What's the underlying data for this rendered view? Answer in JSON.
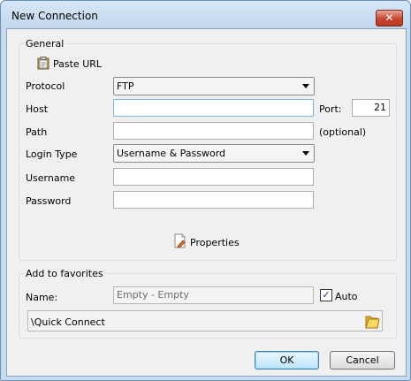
{
  "window": {
    "title": "New Connection",
    "close_label": "✕"
  },
  "general": {
    "group_label": "General",
    "paste_url_label": "Paste URL",
    "protocol_label": "Protocol",
    "protocol_value": "FTP",
    "host_label": "Host",
    "host_value": "",
    "port_label": "Port:",
    "port_value": "21",
    "path_label": "Path",
    "path_value": "",
    "optional_label": "(optional)",
    "login_type_label": "Login Type",
    "login_type_value": "Username & Password",
    "username_label": "Username",
    "username_value": "",
    "password_label": "Password",
    "password_value": "",
    "properties_label": "Properties"
  },
  "favorites": {
    "group_label": "Add to favorites",
    "name_label": "Name:",
    "name_value": "Empty - Empty",
    "auto_label": "Auto",
    "auto_checked": true,
    "folder_path": "\\Quick Connect"
  },
  "buttons": {
    "ok_label": "OK",
    "cancel_label": "Cancel"
  }
}
